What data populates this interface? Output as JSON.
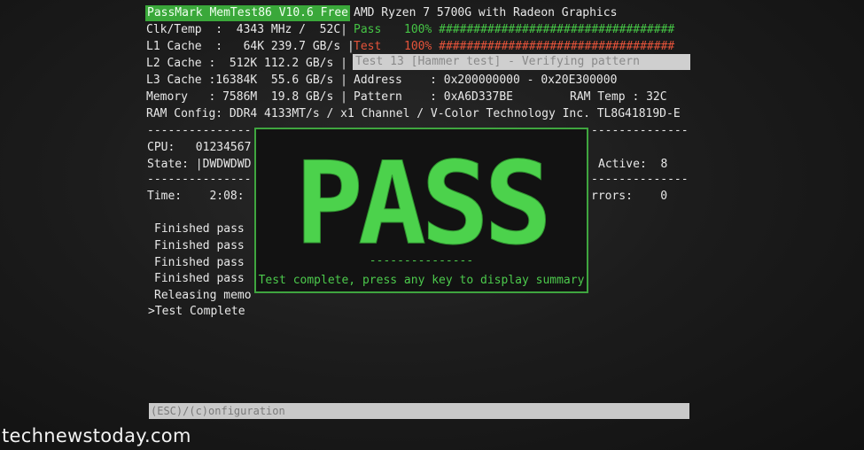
{
  "header": {
    "app_title": "PassMark MemTest86 V10.6 Free",
    "cpu_name": "AMD Ryzen 7 5700G with Radeon Graphics"
  },
  "sysinfo": {
    "clk_temp": "Clk/Temp  :  4343 MHz /  52C|",
    "l1": "L1 Cache  :   64K 239.7 GB/s |",
    "l2": "L2 Cache :  512K 112.2 GB/s |",
    "l3": "L3 Cache :16384K  55.6 GB/s |",
    "memory": "Memory   : 7586M  19.8 GB/s |",
    "ram_config": "RAM Config: DDR4 4133MT/s / x1 Channel / V-Color Technology Inc. TL8G41819D-E"
  },
  "progress": {
    "pass_label": "Pass",
    "pass_value": "100% ##################################",
    "pass_percent": 100,
    "test_label": "Test",
    "test_value": "100% ##################################",
    "test_percent": 100,
    "current_test": "Test 13 [Hammer test] - Verifying pattern",
    "address": "Address    : 0x200000000 - 0x20E300000",
    "pattern": "Pattern    : 0xA6D337BE",
    "ram_temp": "RAM Temp : 32C"
  },
  "status": {
    "cpu": "CPU:   01234567",
    "state": "State: |DWDWDWD",
    "active": "Active:  8",
    "time": "Time:    2:08:",
    "errors": "rrors:    0",
    "separator_left": "---------------",
    "separator_right": "--------------"
  },
  "log": [
    "Finished pass",
    "Finished pass",
    "Finished pass",
    "Finished pass",
    "Releasing memo",
    ">Test Complete"
  ],
  "dialog": {
    "big_text": "PASS",
    "divider": "---------------",
    "message": "Test complete, press any key to display summary",
    "color": "#4cd24c"
  },
  "footer": {
    "hint": "(ESC)/(c)onfiguration"
  },
  "watermark": "technewstoday.com"
}
